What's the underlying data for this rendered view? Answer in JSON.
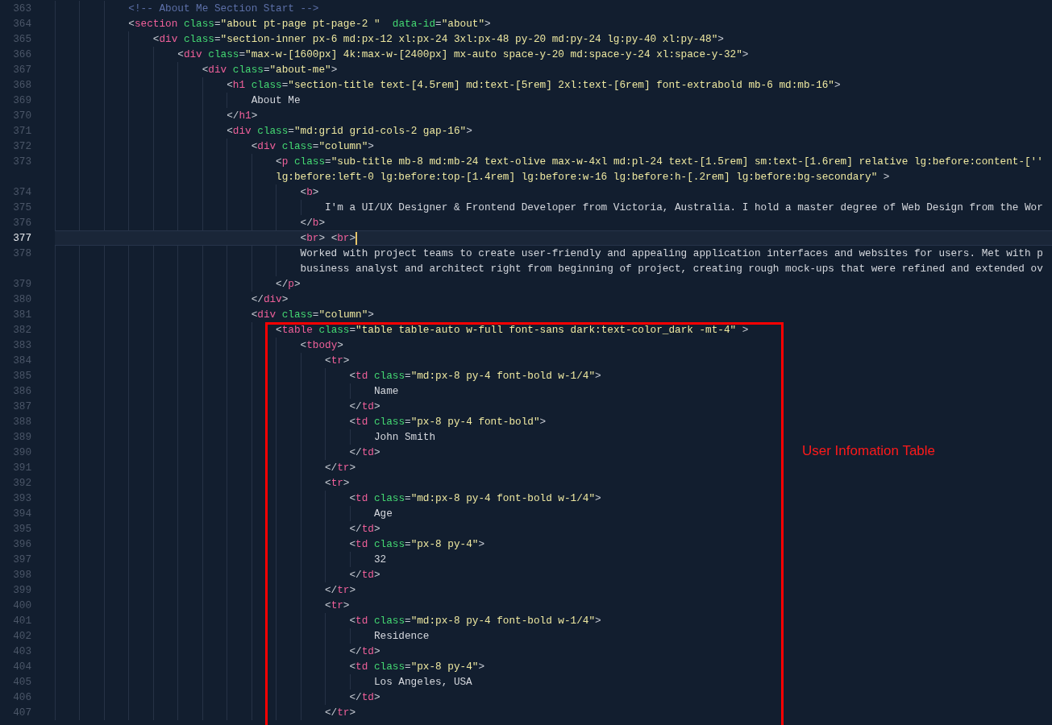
{
  "editor": {
    "lines": [
      {
        "number": "363",
        "current": false,
        "tokens": [
          {
            "kind": "com",
            "text": "            <!-- About Me Section Start -->"
          }
        ]
      },
      {
        "number": "364",
        "current": false,
        "tokens": [
          {
            "kind": "p",
            "text": "            <"
          },
          {
            "kind": "tag",
            "text": "section"
          },
          {
            "kind": "attr",
            "text": " class"
          },
          {
            "kind": "p",
            "text": "="
          },
          {
            "kind": "str",
            "text": "\"about pt-page pt-page-2 \""
          },
          {
            "kind": "attr",
            "text": "  data-id"
          },
          {
            "kind": "p",
            "text": "="
          },
          {
            "kind": "str",
            "text": "\"about\""
          },
          {
            "kind": "p",
            "text": ">"
          }
        ]
      },
      {
        "number": "365",
        "current": false,
        "tokens": [
          {
            "kind": "p",
            "text": "                <"
          },
          {
            "kind": "tag",
            "text": "div"
          },
          {
            "kind": "attr",
            "text": " class"
          },
          {
            "kind": "p",
            "text": "="
          },
          {
            "kind": "str",
            "text": "\"section-inner px-6 md:px-12 xl:px-24 3xl:px-48 py-20 md:py-24 lg:py-40 xl:py-48\""
          },
          {
            "kind": "p",
            "text": ">"
          }
        ]
      },
      {
        "number": "366",
        "current": false,
        "tokens": [
          {
            "kind": "p",
            "text": "                    <"
          },
          {
            "kind": "tag",
            "text": "div"
          },
          {
            "kind": "attr",
            "text": " class"
          },
          {
            "kind": "p",
            "text": "="
          },
          {
            "kind": "str",
            "text": "\"max-w-[1600px] 4k:max-w-[2400px] mx-auto space-y-20 md:space-y-24 xl:space-y-32\""
          },
          {
            "kind": "p",
            "text": ">"
          }
        ]
      },
      {
        "number": "367",
        "current": false,
        "tokens": [
          {
            "kind": "p",
            "text": "                        <"
          },
          {
            "kind": "tag",
            "text": "div"
          },
          {
            "kind": "attr",
            "text": " class"
          },
          {
            "kind": "p",
            "text": "="
          },
          {
            "kind": "str",
            "text": "\"about-me\""
          },
          {
            "kind": "p",
            "text": ">"
          }
        ]
      },
      {
        "number": "368",
        "current": false,
        "tokens": [
          {
            "kind": "p",
            "text": "                            <"
          },
          {
            "kind": "tag",
            "text": "h1"
          },
          {
            "kind": "attr",
            "text": " class"
          },
          {
            "kind": "p",
            "text": "="
          },
          {
            "kind": "str",
            "text": "\"section-title text-[4.5rem] md:text-[5rem] 2xl:text-[6rem] font-extrabold mb-6 md:mb-16\""
          },
          {
            "kind": "p",
            "text": ">"
          }
        ]
      },
      {
        "number": "369",
        "current": false,
        "tokens": [
          {
            "kind": "txt",
            "text": "                                About Me"
          }
        ]
      },
      {
        "number": "370",
        "current": false,
        "tokens": [
          {
            "kind": "p",
            "text": "                            </"
          },
          {
            "kind": "tag",
            "text": "h1"
          },
          {
            "kind": "p",
            "text": ">"
          }
        ]
      },
      {
        "number": "371",
        "current": false,
        "tokens": [
          {
            "kind": "p",
            "text": "                            <"
          },
          {
            "kind": "tag",
            "text": "div"
          },
          {
            "kind": "attr",
            "text": " class"
          },
          {
            "kind": "p",
            "text": "="
          },
          {
            "kind": "str",
            "text": "\"md:grid grid-cols-2 gap-16\""
          },
          {
            "kind": "p",
            "text": ">"
          }
        ]
      },
      {
        "number": "372",
        "current": false,
        "tokens": [
          {
            "kind": "p",
            "text": "                                <"
          },
          {
            "kind": "tag",
            "text": "div"
          },
          {
            "kind": "attr",
            "text": " class"
          },
          {
            "kind": "p",
            "text": "="
          },
          {
            "kind": "str",
            "text": "\"column\""
          },
          {
            "kind": "p",
            "text": ">"
          }
        ]
      },
      {
        "number": "373",
        "current": false,
        "tokens": [
          {
            "kind": "p",
            "text": "                                    <"
          },
          {
            "kind": "tag",
            "text": "p"
          },
          {
            "kind": "attr",
            "text": " class"
          },
          {
            "kind": "p",
            "text": "="
          },
          {
            "kind": "str",
            "text": "\"sub-title mb-8 md:mb-24 text-olive max-w-4xl md:pl-24 text-[1.5rem] sm:text-[1.6rem] relative lg:before:content-[''"
          }
        ]
      },
      {
        "current": false,
        "tokens": [
          {
            "kind": "str",
            "text": "                                    lg:before:left-0 lg:before:top-[1.4rem] lg:before:w-16 lg:before:h-[.2rem] lg:before:bg-secondary\""
          },
          {
            "kind": "p",
            "text": " >"
          }
        ]
      },
      {
        "number": "374",
        "current": false,
        "tokens": [
          {
            "kind": "p",
            "text": "                                        <"
          },
          {
            "kind": "tag",
            "text": "b"
          },
          {
            "kind": "p",
            "text": ">"
          }
        ]
      },
      {
        "number": "375",
        "current": false,
        "tokens": [
          {
            "kind": "txt",
            "text": "                                            I'm a UI/UX Designer & Frontend Developer from Victoria, Australia. I hold a master degree of Web Design from the Wor"
          }
        ]
      },
      {
        "number": "376",
        "current": false,
        "tokens": [
          {
            "kind": "p",
            "text": "                                        </"
          },
          {
            "kind": "tag",
            "text": "b"
          },
          {
            "kind": "p",
            "text": ">"
          }
        ]
      },
      {
        "number": "377",
        "current": true,
        "tokens": [
          {
            "kind": "p",
            "text": "                                        <"
          },
          {
            "kind": "tag",
            "text": "br"
          },
          {
            "kind": "p",
            "text": "> <"
          },
          {
            "kind": "tag",
            "text": "br"
          },
          {
            "kind": "p",
            "text": ">"
          }
        ]
      },
      {
        "number": "378",
        "current": false,
        "tokens": [
          {
            "kind": "txt",
            "text": "                                        Worked with project teams to create user-friendly and appealing application interfaces and websites for users. Met with p"
          }
        ]
      },
      {
        "current": false,
        "tokens": [
          {
            "kind": "txt",
            "text": "                                        business analyst and architect right from beginning of project, creating rough mock-ups that were refined and extended ov"
          }
        ]
      },
      {
        "number": "379",
        "current": false,
        "tokens": [
          {
            "kind": "p",
            "text": "                                    </"
          },
          {
            "kind": "tag",
            "text": "p"
          },
          {
            "kind": "p",
            "text": ">"
          }
        ]
      },
      {
        "number": "380",
        "current": false,
        "tokens": [
          {
            "kind": "p",
            "text": "                                </"
          },
          {
            "kind": "tag",
            "text": "div"
          },
          {
            "kind": "p",
            "text": ">"
          }
        ]
      },
      {
        "number": "381",
        "current": false,
        "tokens": [
          {
            "kind": "p",
            "text": "                                <"
          },
          {
            "kind": "tag",
            "text": "div"
          },
          {
            "kind": "attr",
            "text": " class"
          },
          {
            "kind": "p",
            "text": "="
          },
          {
            "kind": "str",
            "text": "\"column\""
          },
          {
            "kind": "p",
            "text": ">"
          }
        ]
      },
      {
        "number": "382",
        "current": false,
        "tokens": [
          {
            "kind": "p",
            "text": "                                    <"
          },
          {
            "kind": "tag",
            "text": "table"
          },
          {
            "kind": "attr",
            "text": " class"
          },
          {
            "kind": "p",
            "text": "="
          },
          {
            "kind": "str",
            "text": "\"table table-auto w-full font-sans dark:text-color_dark -mt-4\""
          },
          {
            "kind": "p",
            "text": " >"
          }
        ]
      },
      {
        "number": "383",
        "current": false,
        "tokens": [
          {
            "kind": "p",
            "text": "                                        <"
          },
          {
            "kind": "tag",
            "text": "tbody"
          },
          {
            "kind": "p",
            "text": ">"
          }
        ]
      },
      {
        "number": "384",
        "current": false,
        "tokens": [
          {
            "kind": "p",
            "text": "                                            <"
          },
          {
            "kind": "tag",
            "text": "tr"
          },
          {
            "kind": "p",
            "text": ">"
          }
        ]
      },
      {
        "number": "385",
        "current": false,
        "tokens": [
          {
            "kind": "p",
            "text": "                                                <"
          },
          {
            "kind": "tag",
            "text": "td"
          },
          {
            "kind": "attr",
            "text": " class"
          },
          {
            "kind": "p",
            "text": "="
          },
          {
            "kind": "str",
            "text": "\"md:px-8 py-4 font-bold w-1/4\""
          },
          {
            "kind": "p",
            "text": ">"
          }
        ]
      },
      {
        "number": "386",
        "current": false,
        "tokens": [
          {
            "kind": "txt",
            "text": "                                                    Name"
          }
        ]
      },
      {
        "number": "387",
        "current": false,
        "tokens": [
          {
            "kind": "p",
            "text": "                                                </"
          },
          {
            "kind": "tag",
            "text": "td"
          },
          {
            "kind": "p",
            "text": ">"
          }
        ]
      },
      {
        "number": "388",
        "current": false,
        "tokens": [
          {
            "kind": "p",
            "text": "                                                <"
          },
          {
            "kind": "tag",
            "text": "td"
          },
          {
            "kind": "attr",
            "text": " class"
          },
          {
            "kind": "p",
            "text": "="
          },
          {
            "kind": "str",
            "text": "\"px-8 py-4 font-bold\""
          },
          {
            "kind": "p",
            "text": ">"
          }
        ]
      },
      {
        "number": "389",
        "current": false,
        "tokens": [
          {
            "kind": "txt",
            "text": "                                                    John Smith"
          }
        ]
      },
      {
        "number": "390",
        "current": false,
        "tokens": [
          {
            "kind": "p",
            "text": "                                                </"
          },
          {
            "kind": "tag",
            "text": "td"
          },
          {
            "kind": "p",
            "text": ">"
          }
        ]
      },
      {
        "number": "391",
        "current": false,
        "tokens": [
          {
            "kind": "p",
            "text": "                                            </"
          },
          {
            "kind": "tag",
            "text": "tr"
          },
          {
            "kind": "p",
            "text": ">"
          }
        ]
      },
      {
        "number": "392",
        "current": false,
        "tokens": [
          {
            "kind": "p",
            "text": "                                            <"
          },
          {
            "kind": "tag",
            "text": "tr"
          },
          {
            "kind": "p",
            "text": ">"
          }
        ]
      },
      {
        "number": "393",
        "current": false,
        "tokens": [
          {
            "kind": "p",
            "text": "                                                <"
          },
          {
            "kind": "tag",
            "text": "td"
          },
          {
            "kind": "attr",
            "text": " class"
          },
          {
            "kind": "p",
            "text": "="
          },
          {
            "kind": "str",
            "text": "\"md:px-8 py-4 font-bold w-1/4\""
          },
          {
            "kind": "p",
            "text": ">"
          }
        ]
      },
      {
        "number": "394",
        "current": false,
        "tokens": [
          {
            "kind": "txt",
            "text": "                                                    Age"
          }
        ]
      },
      {
        "number": "395",
        "current": false,
        "tokens": [
          {
            "kind": "p",
            "text": "                                                </"
          },
          {
            "kind": "tag",
            "text": "td"
          },
          {
            "kind": "p",
            "text": ">"
          }
        ]
      },
      {
        "number": "396",
        "current": false,
        "tokens": [
          {
            "kind": "p",
            "text": "                                                <"
          },
          {
            "kind": "tag",
            "text": "td"
          },
          {
            "kind": "attr",
            "text": " class"
          },
          {
            "kind": "p",
            "text": "="
          },
          {
            "kind": "str",
            "text": "\"px-8 py-4\""
          },
          {
            "kind": "p",
            "text": ">"
          }
        ]
      },
      {
        "number": "397",
        "current": false,
        "tokens": [
          {
            "kind": "txt",
            "text": "                                                    32"
          }
        ]
      },
      {
        "number": "398",
        "current": false,
        "tokens": [
          {
            "kind": "p",
            "text": "                                                </"
          },
          {
            "kind": "tag",
            "text": "td"
          },
          {
            "kind": "p",
            "text": ">"
          }
        ]
      },
      {
        "number": "399",
        "current": false,
        "tokens": [
          {
            "kind": "p",
            "text": "                                            </"
          },
          {
            "kind": "tag",
            "text": "tr"
          },
          {
            "kind": "p",
            "text": ">"
          }
        ]
      },
      {
        "number": "400",
        "current": false,
        "tokens": [
          {
            "kind": "p",
            "text": "                                            <"
          },
          {
            "kind": "tag",
            "text": "tr"
          },
          {
            "kind": "p",
            "text": ">"
          }
        ]
      },
      {
        "number": "401",
        "current": false,
        "tokens": [
          {
            "kind": "p",
            "text": "                                                <"
          },
          {
            "kind": "tag",
            "text": "td"
          },
          {
            "kind": "attr",
            "text": " class"
          },
          {
            "kind": "p",
            "text": "="
          },
          {
            "kind": "str",
            "text": "\"md:px-8 py-4 font-bold w-1/4\""
          },
          {
            "kind": "p",
            "text": ">"
          }
        ]
      },
      {
        "number": "402",
        "current": false,
        "tokens": [
          {
            "kind": "txt",
            "text": "                                                    Residence"
          }
        ]
      },
      {
        "number": "403",
        "current": false,
        "tokens": [
          {
            "kind": "p",
            "text": "                                                </"
          },
          {
            "kind": "tag",
            "text": "td"
          },
          {
            "kind": "p",
            "text": ">"
          }
        ]
      },
      {
        "number": "404",
        "current": false,
        "tokens": [
          {
            "kind": "p",
            "text": "                                                <"
          },
          {
            "kind": "tag",
            "text": "td"
          },
          {
            "kind": "attr",
            "text": " class"
          },
          {
            "kind": "p",
            "text": "="
          },
          {
            "kind": "str",
            "text": "\"px-8 py-4\""
          },
          {
            "kind": "p",
            "text": ">"
          }
        ]
      },
      {
        "number": "405",
        "current": false,
        "tokens": [
          {
            "kind": "txt",
            "text": "                                                    Los Angeles, USA"
          }
        ]
      },
      {
        "number": "406",
        "current": false,
        "tokens": [
          {
            "kind": "p",
            "text": "                                                </"
          },
          {
            "kind": "tag",
            "text": "td"
          },
          {
            "kind": "p",
            "text": ">"
          }
        ]
      },
      {
        "number": "407",
        "current": false,
        "tokens": [
          {
            "kind": "p",
            "text": "                                            </"
          },
          {
            "kind": "tag",
            "text": "tr"
          },
          {
            "kind": "p",
            "text": ">"
          }
        ]
      }
    ]
  },
  "annotation": {
    "label": "User Infomation Table"
  }
}
